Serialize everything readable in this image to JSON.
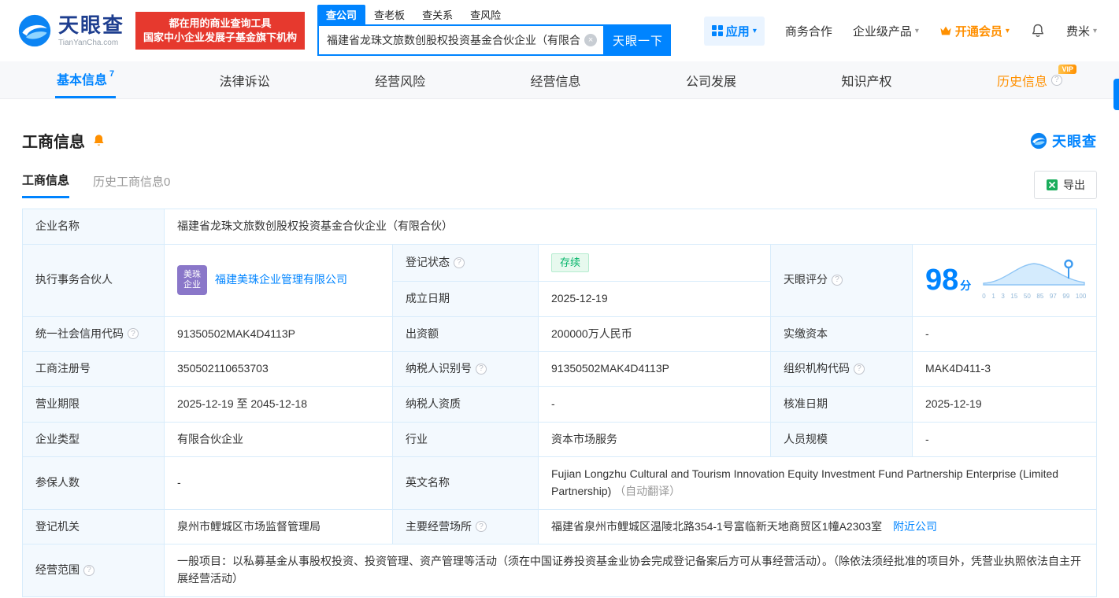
{
  "brand": {
    "name": "天眼查",
    "domain": "TianYanCha.com"
  },
  "header": {
    "banner": {
      "line1": "都在用的商业查询工具",
      "line2": "国家中小企业发展子基金旗下机构"
    },
    "search_tabs": [
      {
        "label": "查公司"
      },
      {
        "label": "查老板"
      },
      {
        "label": "查关系"
      },
      {
        "label": "查风险"
      }
    ],
    "search": {
      "value": "福建省龙珠文旅数创股权投资基金合伙企业（有限合伙",
      "button": "天眼一下"
    },
    "menu": {
      "apps": "应用",
      "cooperation": "商务合作",
      "enterprise": "企业级产品",
      "vip": "开通会员",
      "user": "费米"
    }
  },
  "nav": {
    "tabs": [
      {
        "label": "基本信息",
        "count": "7"
      },
      {
        "label": "法律诉讼"
      },
      {
        "label": "经营风险"
      },
      {
        "label": "经营信息"
      },
      {
        "label": "公司发展"
      },
      {
        "label": "知识产权"
      },
      {
        "label": "历史信息",
        "badge": "VIP"
      }
    ]
  },
  "section": {
    "title": "工商信息",
    "tabs": [
      {
        "label": "工商信息"
      },
      {
        "label": "历史工商信息0"
      }
    ],
    "export_label": "导出"
  },
  "table": {
    "company_name_label": "企业名称",
    "company_name": "福建省龙珠文旅数创股权投资基金合伙企业（有限合伙）",
    "partner_label": "执行事务合伙人",
    "partner_logo_line1": "美珠",
    "partner_logo_line2": "企业",
    "partner_name": "福建美珠企业管理有限公司",
    "reg_status_label": "登记状态",
    "reg_status": "存续",
    "establish_date_label": "成立日期",
    "establish_date": "2025-12-19",
    "score_label": "天眼评分",
    "score_value": "98",
    "score_unit": "分",
    "score_axis": [
      "0",
      "1",
      "3",
      "15",
      "50",
      "85",
      "97",
      "99",
      "100"
    ],
    "credit_code_label": "统一社会信用代码",
    "credit_code": "91350502MAK4D4113P",
    "capital_label": "出资额",
    "capital": "200000万人民币",
    "paid_in_label": "实缴资本",
    "paid_in": "-",
    "reg_no_label": "工商注册号",
    "reg_no": "350502110653703",
    "taxpayer_id_label": "纳税人识别号",
    "taxpayer_id": "91350502MAK4D4113P",
    "org_code_label": "组织机构代码",
    "org_code": "MAK4D411-3",
    "term_label": "营业期限",
    "term": "2025-12-19 至 2045-12-18",
    "taxpayer_quality_label": "纳税人资质",
    "taxpayer_quality": "-",
    "approval_date_label": "核准日期",
    "approval_date": "2025-12-19",
    "type_label": "企业类型",
    "type": "有限合伙企业",
    "industry_label": "行业",
    "industry": "资本市场服务",
    "staff_label": "人员规模",
    "staff": "-",
    "insured_label": "参保人数",
    "insured": "-",
    "en_name_label": "英文名称",
    "en_name": "Fujian Longzhu Cultural and Tourism Innovation Equity Investment Fund Partnership Enterprise (Limited Partnership)",
    "en_name_note": "（自动翻译）",
    "authority_label": "登记机关",
    "authority": "泉州市鲤城区市场监督管理局",
    "premises_label": "主要经营场所",
    "premises": "福建省泉州市鲤城区温陵北路354-1号富临新天地商贸区1幢A2303室",
    "nearby_link": "附近公司",
    "scope_label": "经营范围",
    "scope": "一般项目：以私募基金从事股权投资、投资管理、资产管理等活动（须在中国证券投资基金业协会完成登记备案后方可从事经营活动）。（除依法须经批准的项目外，凭营业执照依法自主开展经营活动）"
  },
  "icons": {
    "help": "?",
    "caret": "▾",
    "clear": "×"
  },
  "colors": {
    "primary": "#0084ff",
    "banner_red": "#e6392e",
    "vip_orange": "#ff9000",
    "status_green": "#00b368",
    "table_border": "#d8ecfb",
    "label_bg": "#f3f9fe"
  }
}
